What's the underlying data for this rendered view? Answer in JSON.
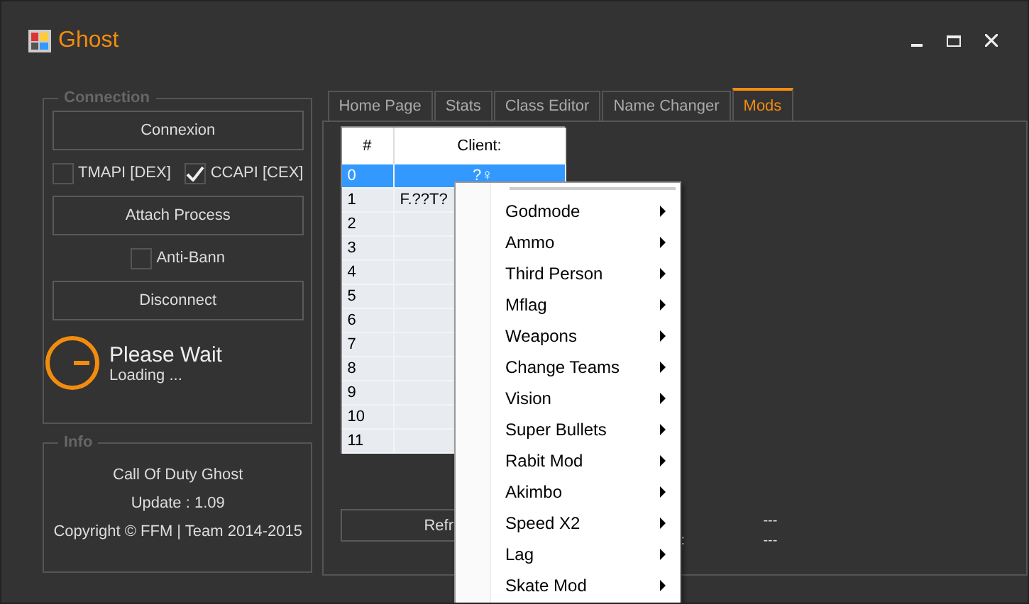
{
  "window": {
    "title": "Ghost"
  },
  "connection": {
    "title": "Connection",
    "connect_button": "Connexion",
    "apis": [
      {
        "label": "TMAPI [DEX]",
        "checked": false
      },
      {
        "label": "CCAPI [CEX]",
        "checked": true
      }
    ],
    "attach_button": "Attach Process",
    "anti_ban": {
      "label": "Anti-Bann",
      "checked": false
    },
    "disconnect_button": "Disconnect",
    "status": {
      "title": "Please Wait",
      "subtitle": "Loading ..."
    }
  },
  "info": {
    "title": "Info",
    "lines": [
      "Call Of Duty Ghost",
      "Update : 1.09",
      "Copyright © FFM | Team 2014-2015"
    ]
  },
  "tabs": [
    {
      "label": "Home Page",
      "selected": false
    },
    {
      "label": "Stats",
      "selected": false
    },
    {
      "label": "Class Editor",
      "selected": false
    },
    {
      "label": "Name Changer",
      "selected": false
    },
    {
      "label": "Mods",
      "selected": true
    }
  ],
  "clients_table": {
    "columns": [
      "#",
      "Client:"
    ],
    "rows": [
      {
        "index": "0",
        "client": "?♀",
        "selected": true
      },
      {
        "index": "1",
        "client": "F.??T?",
        "selected": false
      },
      {
        "index": "2",
        "selected": false
      },
      {
        "index": "3",
        "selected": false
      },
      {
        "index": "4",
        "selected": false
      },
      {
        "index": "5",
        "selected": false
      },
      {
        "index": "6",
        "selected": false
      },
      {
        "index": "7",
        "selected": false
      },
      {
        "index": "8",
        "selected": false
      },
      {
        "index": "9",
        "selected": false
      },
      {
        "index": "10",
        "selected": false
      },
      {
        "index": "11",
        "selected": false
      }
    ]
  },
  "refresh_button": "Refr",
  "stats": [
    {
      "value": "---"
    },
    {
      "label": ":",
      "value": "---"
    }
  ],
  "context_menu": [
    "Godmode",
    "Ammo",
    "Third Person",
    "Mflag",
    "Weapons",
    "Change Teams",
    "Vision",
    "Super Bullets",
    "Rabit Mod",
    "Akimbo",
    "Speed X2",
    "Lag",
    "Skate Mod"
  ]
}
